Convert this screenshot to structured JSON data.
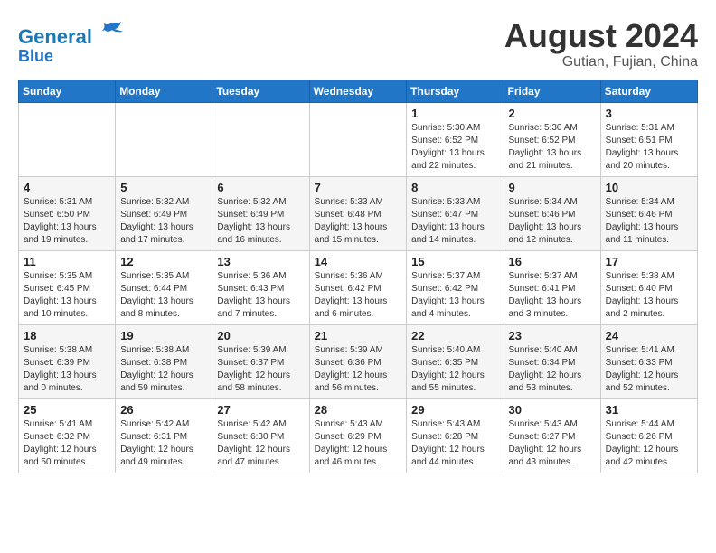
{
  "header": {
    "logo_line1": "General",
    "logo_line2": "Blue",
    "month_year": "August 2024",
    "location": "Gutian, Fujian, China"
  },
  "weekdays": [
    "Sunday",
    "Monday",
    "Tuesday",
    "Wednesday",
    "Thursday",
    "Friday",
    "Saturday"
  ],
  "weeks": [
    [
      {
        "day": "",
        "info": ""
      },
      {
        "day": "",
        "info": ""
      },
      {
        "day": "",
        "info": ""
      },
      {
        "day": "",
        "info": ""
      },
      {
        "day": "1",
        "info": "Sunrise: 5:30 AM\nSunset: 6:52 PM\nDaylight: 13 hours\nand 22 minutes."
      },
      {
        "day": "2",
        "info": "Sunrise: 5:30 AM\nSunset: 6:52 PM\nDaylight: 13 hours\nand 21 minutes."
      },
      {
        "day": "3",
        "info": "Sunrise: 5:31 AM\nSunset: 6:51 PM\nDaylight: 13 hours\nand 20 minutes."
      }
    ],
    [
      {
        "day": "4",
        "info": "Sunrise: 5:31 AM\nSunset: 6:50 PM\nDaylight: 13 hours\nand 19 minutes."
      },
      {
        "day": "5",
        "info": "Sunrise: 5:32 AM\nSunset: 6:49 PM\nDaylight: 13 hours\nand 17 minutes."
      },
      {
        "day": "6",
        "info": "Sunrise: 5:32 AM\nSunset: 6:49 PM\nDaylight: 13 hours\nand 16 minutes."
      },
      {
        "day": "7",
        "info": "Sunrise: 5:33 AM\nSunset: 6:48 PM\nDaylight: 13 hours\nand 15 minutes."
      },
      {
        "day": "8",
        "info": "Sunrise: 5:33 AM\nSunset: 6:47 PM\nDaylight: 13 hours\nand 14 minutes."
      },
      {
        "day": "9",
        "info": "Sunrise: 5:34 AM\nSunset: 6:46 PM\nDaylight: 13 hours\nand 12 minutes."
      },
      {
        "day": "10",
        "info": "Sunrise: 5:34 AM\nSunset: 6:46 PM\nDaylight: 13 hours\nand 11 minutes."
      }
    ],
    [
      {
        "day": "11",
        "info": "Sunrise: 5:35 AM\nSunset: 6:45 PM\nDaylight: 13 hours\nand 10 minutes."
      },
      {
        "day": "12",
        "info": "Sunrise: 5:35 AM\nSunset: 6:44 PM\nDaylight: 13 hours\nand 8 minutes."
      },
      {
        "day": "13",
        "info": "Sunrise: 5:36 AM\nSunset: 6:43 PM\nDaylight: 13 hours\nand 7 minutes."
      },
      {
        "day": "14",
        "info": "Sunrise: 5:36 AM\nSunset: 6:42 PM\nDaylight: 13 hours\nand 6 minutes."
      },
      {
        "day": "15",
        "info": "Sunrise: 5:37 AM\nSunset: 6:42 PM\nDaylight: 13 hours\nand 4 minutes."
      },
      {
        "day": "16",
        "info": "Sunrise: 5:37 AM\nSunset: 6:41 PM\nDaylight: 13 hours\nand 3 minutes."
      },
      {
        "day": "17",
        "info": "Sunrise: 5:38 AM\nSunset: 6:40 PM\nDaylight: 13 hours\nand 2 minutes."
      }
    ],
    [
      {
        "day": "18",
        "info": "Sunrise: 5:38 AM\nSunset: 6:39 PM\nDaylight: 13 hours\nand 0 minutes."
      },
      {
        "day": "19",
        "info": "Sunrise: 5:38 AM\nSunset: 6:38 PM\nDaylight: 12 hours\nand 59 minutes."
      },
      {
        "day": "20",
        "info": "Sunrise: 5:39 AM\nSunset: 6:37 PM\nDaylight: 12 hours\nand 58 minutes."
      },
      {
        "day": "21",
        "info": "Sunrise: 5:39 AM\nSunset: 6:36 PM\nDaylight: 12 hours\nand 56 minutes."
      },
      {
        "day": "22",
        "info": "Sunrise: 5:40 AM\nSunset: 6:35 PM\nDaylight: 12 hours\nand 55 minutes."
      },
      {
        "day": "23",
        "info": "Sunrise: 5:40 AM\nSunset: 6:34 PM\nDaylight: 12 hours\nand 53 minutes."
      },
      {
        "day": "24",
        "info": "Sunrise: 5:41 AM\nSunset: 6:33 PM\nDaylight: 12 hours\nand 52 minutes."
      }
    ],
    [
      {
        "day": "25",
        "info": "Sunrise: 5:41 AM\nSunset: 6:32 PM\nDaylight: 12 hours\nand 50 minutes."
      },
      {
        "day": "26",
        "info": "Sunrise: 5:42 AM\nSunset: 6:31 PM\nDaylight: 12 hours\nand 49 minutes."
      },
      {
        "day": "27",
        "info": "Sunrise: 5:42 AM\nSunset: 6:30 PM\nDaylight: 12 hours\nand 47 minutes."
      },
      {
        "day": "28",
        "info": "Sunrise: 5:43 AM\nSunset: 6:29 PM\nDaylight: 12 hours\nand 46 minutes."
      },
      {
        "day": "29",
        "info": "Sunrise: 5:43 AM\nSunset: 6:28 PM\nDaylight: 12 hours\nand 44 minutes."
      },
      {
        "day": "30",
        "info": "Sunrise: 5:43 AM\nSunset: 6:27 PM\nDaylight: 12 hours\nand 43 minutes."
      },
      {
        "day": "31",
        "info": "Sunrise: 5:44 AM\nSunset: 6:26 PM\nDaylight: 12 hours\nand 42 minutes."
      }
    ]
  ]
}
